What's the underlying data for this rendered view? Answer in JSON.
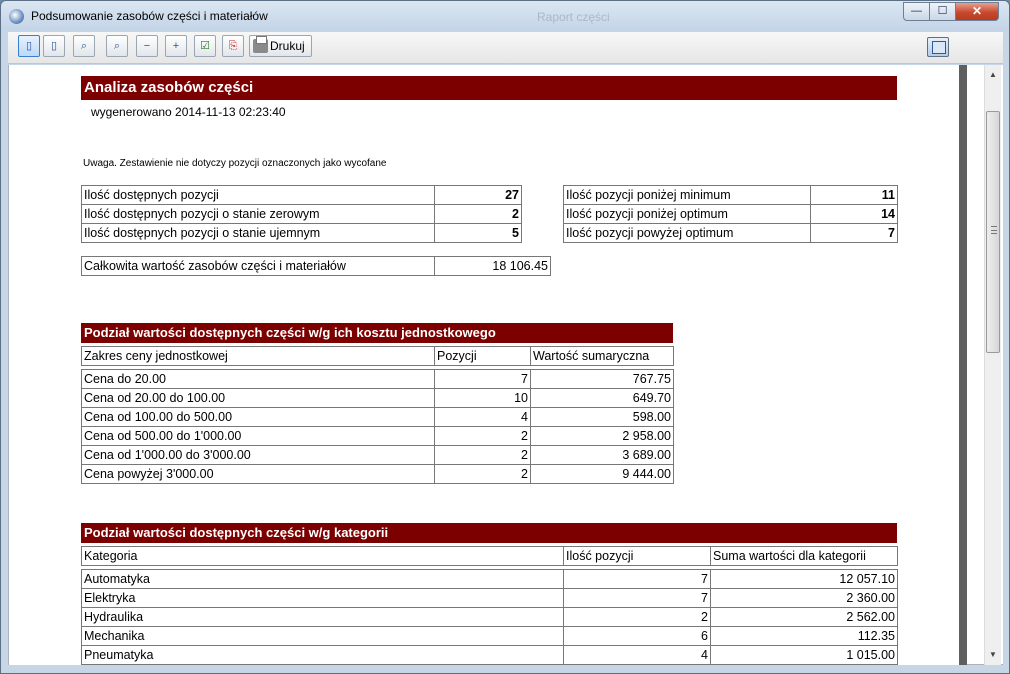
{
  "window": {
    "title": "Podsumowanie zasobów części i materiałów",
    "background_title": "Raport części",
    "controls": {
      "minimize": "—",
      "maximize": "☐",
      "close": "✕"
    }
  },
  "toolbar": {
    "print_label": "Drukuj",
    "icons": [
      "page-first-icon",
      "page-last-icon",
      "zoom-fit-icon",
      "zoom-page-icon",
      "zoom-out-icon",
      "zoom-in-icon",
      "checkbox-icon",
      "pdf-export-icon",
      "printer-icon",
      "restore-window-icon"
    ]
  },
  "report": {
    "title": "Analiza zasobów części",
    "generated": "wygenerowano 2014-11-13 02:23:40",
    "note": "Uwaga. Zestawienie nie dotyczy pozycji oznaczonych jako wycofane",
    "summary_left": [
      {
        "label": "Ilość dostępnych pozycji",
        "value": "27"
      },
      {
        "label": "Ilość dostępnych pozycji o stanie zerowym",
        "value": "2"
      },
      {
        "label": "Ilość dostępnych pozycji o stanie ujemnym",
        "value": "5"
      }
    ],
    "summary_right": [
      {
        "label": "Ilość pozycji poniżej minimum",
        "value": "11"
      },
      {
        "label": "Ilość pozycji poniżej optimum",
        "value": "14"
      },
      {
        "label": "Ilość pozycji powyżej optimum",
        "value": "7"
      }
    ],
    "total": {
      "label": "Całkowita wartość zasobów części i materiałów",
      "value": "18 106.45"
    },
    "price_section": {
      "title": "Podział wartości dostępnych części w/g ich kosztu jednostkowego",
      "headers": [
        "Zakres ceny jednostkowej",
        "Pozycji",
        "Wartość sumaryczna"
      ],
      "rows": [
        [
          "Cena do 20.00",
          "7",
          "767.75"
        ],
        [
          "Cena od 20.00 do 100.00",
          "10",
          "649.70"
        ],
        [
          "Cena od 100.00 do 500.00",
          "4",
          "598.00"
        ],
        [
          "Cena od 500.00 do 1'000.00",
          "2",
          "2 958.00"
        ],
        [
          "Cena od 1'000.00 do 3'000.00",
          "2",
          "3 689.00"
        ],
        [
          "Cena powyżej 3'000.00",
          "2",
          "9 444.00"
        ]
      ]
    },
    "category_section": {
      "title": "Podział wartości dostępnych części w/g kategorii",
      "headers": [
        "Kategoria",
        "Ilość pozycji",
        "Suma wartości dla kategorii"
      ],
      "rows": [
        [
          "Automatyka",
          "7",
          "12 057.10"
        ],
        [
          "Elektryka",
          "7",
          "2 360.00"
        ],
        [
          "Hydraulika",
          "2",
          "2 562.00"
        ],
        [
          "Mechanika",
          "6",
          "112.35"
        ],
        [
          "Pneumatyka",
          "4",
          "1 015.00"
        ]
      ]
    }
  },
  "scrollbar": {
    "up_arrow": "▲",
    "down_arrow": "▼"
  }
}
